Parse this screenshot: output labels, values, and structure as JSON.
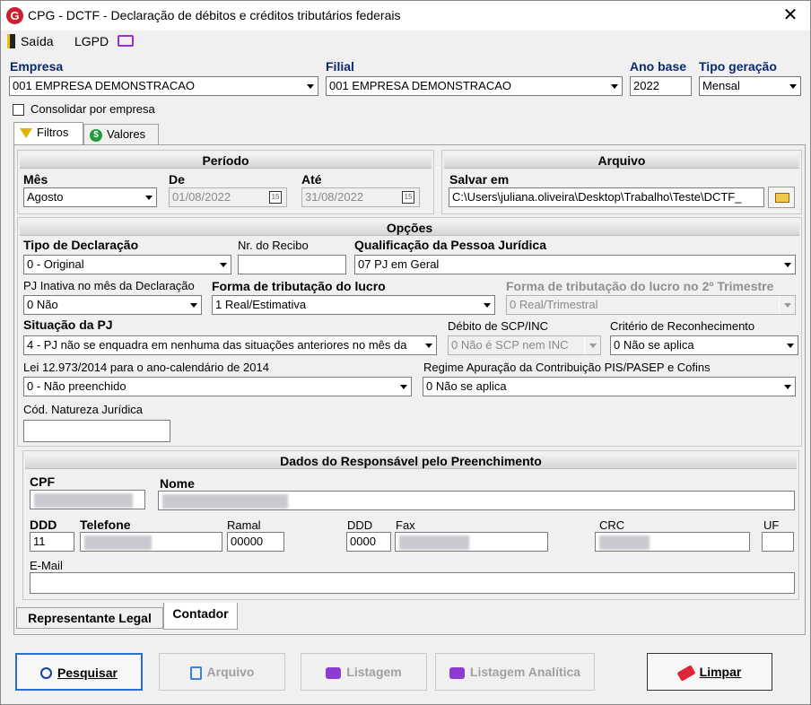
{
  "window": {
    "title": "CPG - DCTF - Declaração de débitos e créditos tributários federais",
    "logo_letter": "G"
  },
  "menu": {
    "saida": "Saída",
    "lgpd": "LGPD"
  },
  "header": {
    "empresa_label": "Empresa",
    "empresa_value": "001 EMPRESA DEMONSTRACAO",
    "filial_label": "Filial",
    "filial_value": "001 EMPRESA DEMONSTRACAO",
    "ano_label": "Ano base",
    "ano_value": "2022",
    "tipo_label": "Tipo geração",
    "tipo_value": "Mensal",
    "consolidar_label": "Consolidar por empresa"
  },
  "tabs": {
    "filtros": "Filtros",
    "valores": "Valores"
  },
  "periodo": {
    "title": "Período",
    "mes_label": "Mês",
    "mes_value": "Agosto",
    "de_label": "De",
    "de_value": "01/08/2022",
    "ate_label": "Até",
    "ate_value": "31/08/2022",
    "cal_glyph": "15"
  },
  "arquivo": {
    "title": "Arquivo",
    "salvar_label": "Salvar em",
    "salvar_value": "C:\\Users\\juliana.oliveira\\Desktop\\Trabalho\\Teste\\DCTF_"
  },
  "opcoes": {
    "title": "Opções",
    "tipo_decl_label": "Tipo de Declaração",
    "tipo_decl_value": "0 - Original",
    "recibo_label": "Nr. do Recibo",
    "recibo_value": "",
    "qualif_label": "Qualificação da Pessoa Jurídica",
    "qualif_value": "07 PJ em Geral",
    "inativa_label": "PJ Inativa no mês da Declaração",
    "inativa_value": "0 Não",
    "forma_label": "Forma de tributação do lucro",
    "forma_value": "1 Real/Estimativa",
    "forma2_label": "Forma de tributação do lucro no 2º Trimestre",
    "forma2_value": "0 Real/Trimestral",
    "situacao_label": "Situação da PJ",
    "situacao_value": "4 - PJ não se enquadra em nenhuma das situações anteriores no mês da",
    "debito_label": "Débito de SCP/INC",
    "debito_value": "0 Não é SCP nem INC",
    "criterio_label": "Critério de Reconhecimento",
    "criterio_value": "0 Não se aplica",
    "lei_label": "Lei 12.973/2014 para o ano-calendário de 2014",
    "lei_value": "0 - Não preenchido",
    "regime_label": "Regime Apuração da Contribuição PIS/PASEP e Cofins",
    "regime_value": "0 Não se aplica",
    "natureza_label": "Cód. Natureza Jurídica",
    "natureza_value": ""
  },
  "responsavel": {
    "title": "Dados do Responsável pelo Preenchimento",
    "cpf_label": "CPF",
    "nome_label": "Nome",
    "ddd_label": "DDD",
    "ddd_value": "11",
    "telefone_label": "Telefone",
    "ramal_label": "Ramal",
    "ramal_value": "00000",
    "ddd_fax_label": "DDD",
    "ddd_fax_value": "0000",
    "fax_label": "Fax",
    "crc_label": "CRC",
    "uf_label": "UF",
    "email_label": "E-Mail"
  },
  "subtabs": {
    "representante": "Representante Legal",
    "contador": "Contador"
  },
  "buttons": {
    "pesquisar": "Pesquisar",
    "arquivo": "Arquivo",
    "listagem": "Listagem",
    "listagem_analitica": "Listagem Analítica",
    "limpar": "Limpar"
  },
  "colors": {
    "accent": "#2b6cd6",
    "brand": "#cc1f2d",
    "section_title": "#0a2a6b"
  }
}
